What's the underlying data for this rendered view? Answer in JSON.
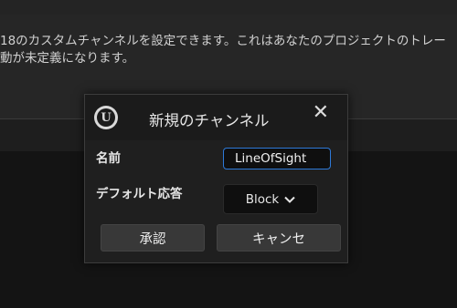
{
  "background": {
    "description_line1": "18のカスタムチャンネルを設定できます。これはあなたのプロジェクトのトレー",
    "description_line2": "動が未定義になります。"
  },
  "dialog": {
    "title": "新規のチャンネル",
    "close_glyph": "✕",
    "logo_glyph": "U",
    "name_label": "名前",
    "name_value": "LineOfSight",
    "default_response_label": "デフォルト応答",
    "default_response_value": "Block",
    "confirm_label": "承認",
    "cancel_label": "キャンセ"
  },
  "icons": {
    "logo": "unreal-logo-icon",
    "close": "close-icon",
    "dropdown": "chevron-down-icon"
  },
  "colors": {
    "accent": "#2d79d8",
    "dialog_bg": "#1f1f1f",
    "button_bg": "#383838"
  }
}
